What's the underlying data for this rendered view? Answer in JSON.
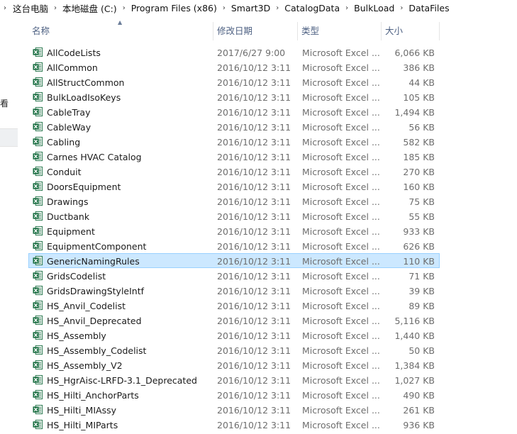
{
  "breadcrumb": {
    "items": [
      "这台电脑",
      "本地磁盘 (C:)",
      "Program Files (x86)",
      "Smart3D",
      "CatalogData",
      "BulkLoad",
      "DataFiles"
    ]
  },
  "left_pane": {
    "partial_text": "看"
  },
  "columns": {
    "name": "名称",
    "date": "修改日期",
    "type": "类型",
    "size": "大小"
  },
  "colors": {
    "selected_bg": "#cce8ff",
    "selected_border": "#99d1ff",
    "excel_green": "#1e7145",
    "header_text": "#4d6082"
  },
  "files": [
    {
      "name": "AllCodeLists",
      "date": "2017/6/27 9:00",
      "type": "Microsoft Excel ...",
      "size": "6,066 KB",
      "icon": "excel-file-icon",
      "selected": false
    },
    {
      "name": "AllCommon",
      "date": "2016/10/12 3:11",
      "type": "Microsoft Excel ...",
      "size": "386 KB",
      "icon": "excel-file-icon",
      "selected": false
    },
    {
      "name": "AllStructCommon",
      "date": "2016/10/12 3:11",
      "type": "Microsoft Excel ...",
      "size": "44 KB",
      "icon": "excel-file-icon",
      "selected": false
    },
    {
      "name": "BulkLoadIsoKeys",
      "date": "2016/10/12 3:11",
      "type": "Microsoft Excel ...",
      "size": "105 KB",
      "icon": "excel-file-icon",
      "selected": false
    },
    {
      "name": "CableTray",
      "date": "2016/10/12 3:11",
      "type": "Microsoft Excel ...",
      "size": "1,494 KB",
      "icon": "excel-file-icon",
      "selected": false
    },
    {
      "name": "CableWay",
      "date": "2016/10/12 3:11",
      "type": "Microsoft Excel ...",
      "size": "56 KB",
      "icon": "excel-file-icon",
      "selected": false
    },
    {
      "name": "Cabling",
      "date": "2016/10/12 3:11",
      "type": "Microsoft Excel ...",
      "size": "582 KB",
      "icon": "excel-file-icon",
      "selected": false
    },
    {
      "name": "Carnes HVAC Catalog",
      "date": "2016/10/12 3:11",
      "type": "Microsoft Excel ...",
      "size": "185 KB",
      "icon": "excel-file-icon",
      "selected": false
    },
    {
      "name": "Conduit",
      "date": "2016/10/12 3:11",
      "type": "Microsoft Excel ...",
      "size": "270 KB",
      "icon": "excel-file-icon",
      "selected": false
    },
    {
      "name": "DoorsEquipment",
      "date": "2016/10/12 3:11",
      "type": "Microsoft Excel ...",
      "size": "160 KB",
      "icon": "excel-file-icon",
      "selected": false
    },
    {
      "name": "Drawings",
      "date": "2016/10/12 3:11",
      "type": "Microsoft Excel ...",
      "size": "75 KB",
      "icon": "excel-file-icon",
      "selected": false
    },
    {
      "name": "Ductbank",
      "date": "2016/10/12 3:11",
      "type": "Microsoft Excel ...",
      "size": "55 KB",
      "icon": "excel-file-icon",
      "selected": false
    },
    {
      "name": "Equipment",
      "date": "2016/10/12 3:11",
      "type": "Microsoft Excel ...",
      "size": "933 KB",
      "icon": "excel-file-icon",
      "selected": false
    },
    {
      "name": "EquipmentComponent",
      "date": "2016/10/12 3:11",
      "type": "Microsoft Excel ...",
      "size": "626 KB",
      "icon": "excel-file-icon",
      "selected": false
    },
    {
      "name": "GenericNamingRules",
      "date": "2016/10/12 3:11",
      "type": "Microsoft Excel ...",
      "size": "110 KB",
      "icon": "excel-file-icon",
      "selected": true
    },
    {
      "name": "GridsCodelist",
      "date": "2016/10/12 3:11",
      "type": "Microsoft Excel ...",
      "size": "71 KB",
      "icon": "excel-file-icon",
      "selected": false
    },
    {
      "name": "GridsDrawingStyleIntf",
      "date": "2016/10/12 3:11",
      "type": "Microsoft Excel ...",
      "size": "39 KB",
      "icon": "excel-file-icon",
      "selected": false
    },
    {
      "name": "HS_Anvil_Codelist",
      "date": "2016/10/12 3:11",
      "type": "Microsoft Excel ...",
      "size": "89 KB",
      "icon": "excel-file-icon",
      "selected": false
    },
    {
      "name": "HS_Anvil_Deprecated",
      "date": "2016/10/12 3:11",
      "type": "Microsoft Excel ...",
      "size": "5,116 KB",
      "icon": "excel-file-icon",
      "selected": false
    },
    {
      "name": "HS_Assembly",
      "date": "2016/10/12 3:11",
      "type": "Microsoft Excel ...",
      "size": "1,440 KB",
      "icon": "excel-file-icon",
      "selected": false
    },
    {
      "name": "HS_Assembly_Codelist",
      "date": "2016/10/12 3:11",
      "type": "Microsoft Excel ...",
      "size": "50 KB",
      "icon": "excel-file-icon",
      "selected": false
    },
    {
      "name": "HS_Assembly_V2",
      "date": "2016/10/12 3:11",
      "type": "Microsoft Excel ...",
      "size": "1,384 KB",
      "icon": "excel-file-icon",
      "selected": false
    },
    {
      "name": "HS_HgrAisc-LRFD-3.1_Deprecated",
      "date": "2016/10/12 3:11",
      "type": "Microsoft Excel ...",
      "size": "1,027 KB",
      "icon": "excel-file-icon",
      "selected": false
    },
    {
      "name": "HS_Hilti_AnchorParts",
      "date": "2016/10/12 3:11",
      "type": "Microsoft Excel ...",
      "size": "490 KB",
      "icon": "excel-file-icon",
      "selected": false
    },
    {
      "name": "HS_Hilti_MIAssy",
      "date": "2016/10/12 3:11",
      "type": "Microsoft Excel ...",
      "size": "261 KB",
      "icon": "excel-file-icon",
      "selected": false
    },
    {
      "name": "HS_Hilti_MIParts",
      "date": "2016/10/12 3:11",
      "type": "Microsoft Excel ...",
      "size": "936 KB",
      "icon": "excel-file-icon",
      "selected": false
    }
  ]
}
